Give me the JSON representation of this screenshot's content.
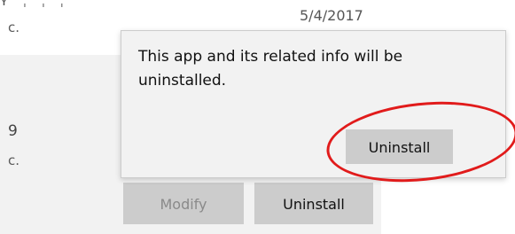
{
  "list": {
    "row_top_fragment": "ʏ   ˌ   ˌ   ˌ",
    "row_top_publisher_fragment": "c.",
    "row_top_date": "5/4/2017",
    "row_selected_name_fragment": "9",
    "row_selected_publisher_fragment": "c."
  },
  "flyout": {
    "message": "This app and its related info will be uninstalled.",
    "confirm_label": "Uninstall"
  },
  "actions": {
    "modify_label": "Modify",
    "uninstall_label": "Uninstall"
  },
  "colors": {
    "flyout_bg": "#f2f2f2",
    "button_bg": "#cccccc",
    "disabled_text": "#8a8a8a",
    "annotation": "#e11b1b"
  }
}
